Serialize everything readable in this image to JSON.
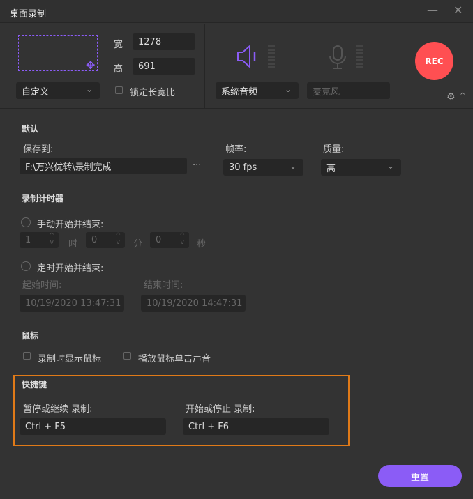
{
  "window": {
    "title": "桌面录制",
    "minimize": "—",
    "close": "✕"
  },
  "capture": {
    "width_label": "宽",
    "width": "1278",
    "height_label": "高",
    "height": "691",
    "preset": "自定义",
    "lock_ratio": "锁定长宽比"
  },
  "audio": {
    "system": "系统音频",
    "mic": "麦克风"
  },
  "rec": {
    "label": "REC"
  },
  "defaults": {
    "heading": "默认",
    "save_label": "保存到:",
    "save_path": "F:\\万兴优转\\录制完成",
    "browse": "···",
    "fps_label": "帧率:",
    "fps": "30 fps",
    "quality_label": "质量:",
    "quality": "高"
  },
  "timer": {
    "heading": "录制计时器",
    "manual": "手动开始并结束:",
    "hours": "1",
    "h_unit": "时",
    "minutes": "0",
    "m_unit": "分",
    "seconds": "0",
    "s_unit": "秒",
    "scheduled": "定时开始并结束:",
    "start_label": "起始时间:",
    "start": "10/19/2020 13:47:31",
    "end_label": "结束时间:",
    "end": "10/19/2020 14:47:31"
  },
  "mouse": {
    "heading": "鼠标",
    "show_cursor": "录制时显示鼠标",
    "click_sound": "播放鼠标单击声音"
  },
  "hotkeys": {
    "heading": "快捷键",
    "pause_label": "暂停或继续 录制:",
    "pause": "Ctrl + F5",
    "start_label": "开始或停止 录制:",
    "start": "Ctrl + F6"
  },
  "footer": {
    "reset": "重置"
  },
  "colors": {
    "accent": "#8b5cf6",
    "rec": "#ff4f52",
    "highlight": "#e07a18"
  }
}
